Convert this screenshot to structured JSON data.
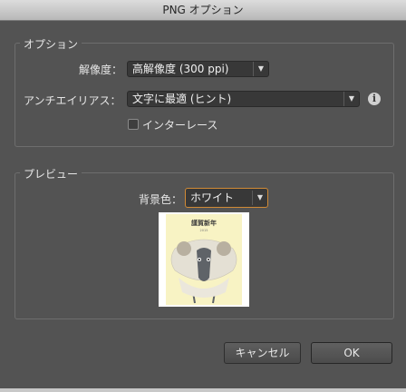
{
  "window": {
    "title": "PNG オプション"
  },
  "options": {
    "group_title": "オプション",
    "resolution_label": "解像度：",
    "resolution_value": "高解像度 (300 ppi)",
    "antialias_label": "アンチエイリアス：",
    "antialias_value": "文字に最適 (ヒント)",
    "interlace_label": "インターレース",
    "interlace_checked": false
  },
  "preview": {
    "group_title": "プレビュー",
    "background_label": "背景色：",
    "background_value": "ホワイト",
    "thumbnail_text": "謹賀新年",
    "thumbnail_subtext": "2015"
  },
  "buttons": {
    "cancel": "キャンセル",
    "ok": "OK"
  },
  "icons": {
    "info": "info-icon",
    "dropdown": "chevron-down-icon"
  },
  "colors": {
    "focus_border": "#d08a36",
    "panel_bg": "#535353"
  }
}
